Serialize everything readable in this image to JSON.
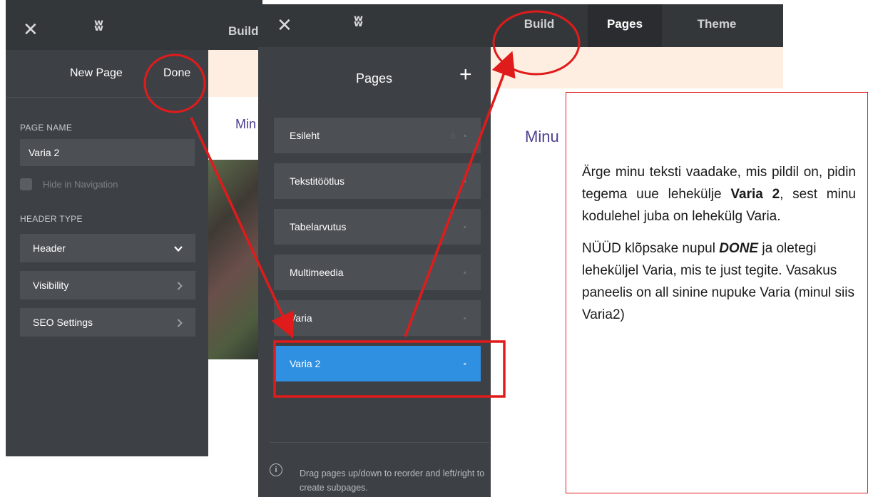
{
  "left": {
    "close_glyph": "✕",
    "logo_glyph": "ʬ",
    "build_label": "Build",
    "panel": {
      "title": "New Page",
      "done_label": "Done",
      "page_name_label": "PAGE NAME",
      "page_name_value": "Varia 2",
      "hide_nav_label": "Hide in Navigation",
      "header_type_label": "HEADER TYPE",
      "header_select": "Header",
      "visibility_label": "Visibility",
      "seo_label": "SEO Settings"
    },
    "preview_title": "Min"
  },
  "right": {
    "close_glyph": "✕",
    "logo_glyph": "ʬ",
    "tabs": {
      "build": "Build",
      "pages": "Pages",
      "theme": "Theme"
    },
    "panel_title": "Pages",
    "add_glyph": "+",
    "pages": [
      {
        "label": "Esileht",
        "icons": "⌂ ▪"
      },
      {
        "label": "Tekstitöötlus",
        "icons": "▪"
      },
      {
        "label": "Tabelarvutus",
        "icons": "▪"
      },
      {
        "label": "Multimeedia",
        "icons": "▪"
      },
      {
        "label": "Varia",
        "icons": "▪"
      },
      {
        "label": "Varia 2",
        "icons": "▪",
        "active": true
      }
    ],
    "info_glyph": "i",
    "info_text": "Drag pages up/down to reorder and left/right to create subpages.",
    "preview_title": "Minu"
  },
  "callout": {
    "p1_before": "Ärge minu teksti vaadake, mis pildil on, pidin tegema uue lehekülje ",
    "p1_bold": "Varia 2",
    "p1_after": ", sest minu kodulehel juba on lehekülg Varia.",
    "p2_before": "NÜÜD klõpsake nupul ",
    "p2_bold": "DONE",
    "p2_after": " ja oletegi leheküljel Varia, mis te just tegite. Vasakus paneelis on all sinine nupuke Varia (minul siis Varia2)"
  },
  "colors": {
    "topbar": "#34373a",
    "panel": "#3d4145",
    "row": "#4c5054",
    "active_page": "#2f8fe0",
    "annotation": "#e01b1b",
    "site_title": "#4d3f8f",
    "banner": "#fdeee1"
  }
}
